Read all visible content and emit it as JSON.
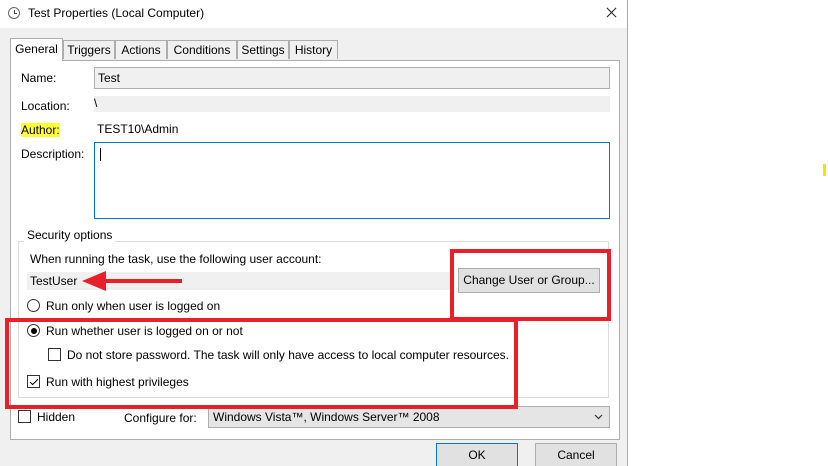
{
  "window": {
    "title": "Test Properties (Local Computer)"
  },
  "tabs": [
    {
      "label": "General",
      "active": true
    },
    {
      "label": "Triggers"
    },
    {
      "label": "Actions"
    },
    {
      "label": "Conditions"
    },
    {
      "label": "Settings"
    },
    {
      "label": "History"
    }
  ],
  "general": {
    "name_label": "Name:",
    "name_value": "Test",
    "location_label": "Location:",
    "location_value": "\\",
    "author_label": "Author:",
    "author_value": "TEST10\\Admin",
    "description_label": "Description:",
    "description_value": ""
  },
  "security": {
    "group_title": "Security options",
    "account_prompt": "When running the task, use the following user account:",
    "user_account": "TestUser",
    "change_button": "Change User or Group...",
    "radio_logged_on": "Run only when user is logged on",
    "radio_whether": "Run whether user is logged on or not",
    "no_store_password": "Do not store password.  The task will only have access to local computer resources.",
    "highest_privileges": "Run with highest privileges",
    "selected_option": "Run whether user is logged on or not",
    "no_store_password_checked": false,
    "highest_privileges_checked": true
  },
  "footer": {
    "hidden_label": "Hidden",
    "hidden_checked": false,
    "configure_label": "Configure for:",
    "configure_value": "Windows Vista™, Windows Server™ 2008",
    "ok_button": "OK",
    "cancel_button": "Cancel"
  },
  "annotations": {
    "highlight_color": "#ffff33",
    "callout_color": "#e8202a"
  }
}
